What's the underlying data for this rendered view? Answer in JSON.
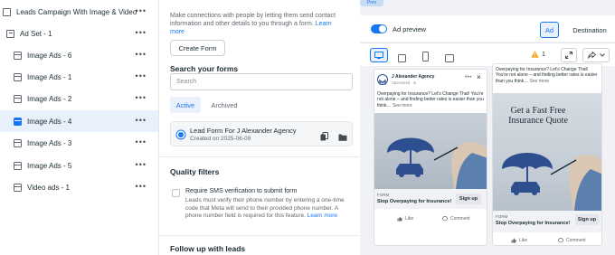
{
  "sidebar": {
    "campaign": {
      "label": "Leads Campaign With Image & Video",
      "more": "•••"
    },
    "adset": {
      "label": "Ad Set - 1",
      "more": "•••"
    },
    "ads": [
      {
        "label": "Image Ads - 6",
        "more": "•••"
      },
      {
        "label": "Image Ads - 1",
        "more": "•••"
      },
      {
        "label": "Image Ads - 2",
        "more": "•••"
      },
      {
        "label": "Image Ads - 4",
        "more": "•••",
        "selected": true
      },
      {
        "label": "Image Ads - 3",
        "more": "•••"
      },
      {
        "label": "Image Ads - 5",
        "more": "•••"
      },
      {
        "label": "Video ads - 1",
        "more": "•••"
      }
    ]
  },
  "form_panel": {
    "intro_text": "Make connections with people by letting them send contact information and other details to you through a form.",
    "intro_link": "Learn more",
    "create_form_label": "Create Form",
    "search_title": "Search your forms",
    "search_placeholder": "Search",
    "tabs": [
      {
        "label": "Active",
        "active": true
      },
      {
        "label": "Archived",
        "active": false
      }
    ],
    "selected_form": {
      "name": "Lead Form For J Alexander Agency",
      "created": "Created on 2025-06-09"
    },
    "quality_title": "Quality filters",
    "sms_title": "Require SMS verification to submit form",
    "sms_desc": "Leads must verify their phone number by entering a one-time code that Meta will send to their provided phone number. A phone number field is required for this feature.",
    "sms_link": "Learn more",
    "followup_title": "Follow up with leads"
  },
  "preview": {
    "top_pill": "Prev",
    "ad_preview_label": "Ad preview",
    "toggle_on": true,
    "segments": [
      {
        "label": "Ad",
        "active": true
      },
      {
        "label": "Destination",
        "active": false
      }
    ],
    "warning_count": "1",
    "cards": [
      {
        "page_name": "J Alexander Agency",
        "sponsored": "Sponsored · ⊕",
        "body": "Overpaying for Insurance? Let's Change That! You're not alone – and finding better rates is easier than you think… ",
        "see_more": "See more",
        "image_headline": "",
        "cta_label": "FORM",
        "cta_headline": "Stop Overpaying for Insurance!",
        "cta_button": "Sign up",
        "like": "Like",
        "comment": "Comment"
      },
      {
        "body": "Overpaying for Insurance? Let's Change That! You're not alone – and finding better rates is easier than you think… ",
        "see_more": "See more",
        "image_headline": "Get a Fast Free Insurance Quote",
        "cta_label": "FORM",
        "cta_headline": "Stop Overpaying for Insurance!",
        "cta_button": "Sign up",
        "like": "Like",
        "comment": "Comment"
      }
    ]
  },
  "colors": {
    "accent": "#1877f2",
    "selected_row_bg": "#e7f0fb",
    "warning": "#f5a623",
    "umbrella": "#2d4f8f"
  }
}
